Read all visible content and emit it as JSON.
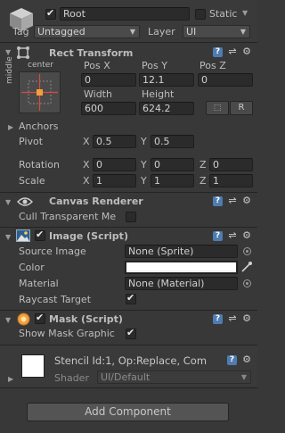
{
  "header": {
    "name": "Root",
    "static_label": "Static",
    "tag_label": "Tag",
    "tag_value": "Untagged",
    "layer_label": "Layer",
    "layer_value": "UI"
  },
  "rect_transform": {
    "title": "Rect Transform",
    "anchor_h": "center",
    "anchor_v": "middle",
    "pos_x_label": "Pos X",
    "pos_y_label": "Pos Y",
    "pos_z_label": "Pos Z",
    "pos_x": "0",
    "pos_y": "12.1",
    "pos_z": "0",
    "width_label": "Width",
    "height_label": "Height",
    "width": "600",
    "height": "624.2",
    "r_button": "R",
    "anchors_label": "Anchors",
    "pivot_label": "Pivot",
    "pivot_x_label": "X",
    "pivot_x": "0.5",
    "pivot_y_label": "Y",
    "pivot_y": "0.5",
    "rotation_label": "Rotation",
    "rot_x_label": "X",
    "rot_x": "0",
    "rot_y_label": "Y",
    "rot_y": "0",
    "rot_z_label": "Z",
    "rot_z": "0",
    "scale_label": "Scale",
    "scale_x_label": "X",
    "scale_x": "1",
    "scale_y_label": "Y",
    "scale_y": "1",
    "scale_z_label": "Z",
    "scale_z": "1"
  },
  "canvas_renderer": {
    "title": "Canvas Renderer",
    "cull_label": "Cull Transparent Me"
  },
  "image": {
    "title": "Image (Script)",
    "source_label": "Source Image",
    "source_value": "None (Sprite)",
    "color_label": "Color",
    "material_label": "Material",
    "material_value": "None (Material)",
    "raycast_label": "Raycast Target"
  },
  "mask": {
    "title": "Mask (Script)",
    "show_graphic_label": "Show Mask Graphic"
  },
  "material_preview": {
    "title": "Stencil Id:1, Op:Replace, Com",
    "shader_label": "Shader",
    "shader_value": "UI/Default"
  },
  "add_component_label": "Add Component",
  "colors": {
    "panel_bg": "#383838",
    "field_bg": "#2b2b2b",
    "accent_blue": "#4f7cb0",
    "swatch": "#ffffff"
  }
}
